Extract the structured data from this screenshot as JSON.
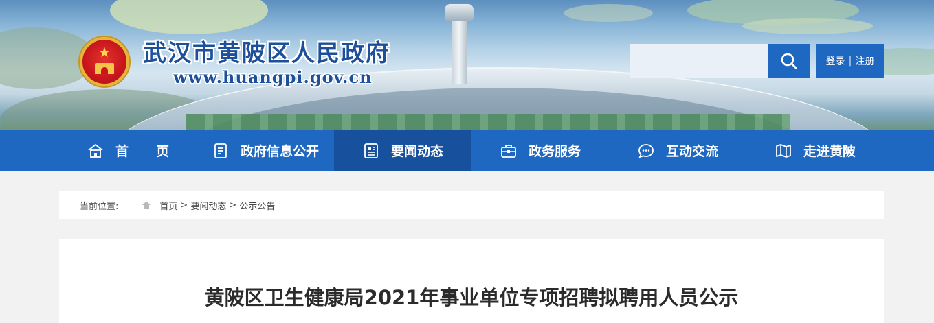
{
  "header": {
    "site_title": "武汉市黄陂区人民政府",
    "site_url": "www.huangpi.gov.cn",
    "search": {
      "placeholder": ""
    },
    "auth": {
      "login": "登录",
      "separator": "|",
      "register": "注册"
    }
  },
  "nav": {
    "items": [
      {
        "label": "首页",
        "icon": "home-icon",
        "active": false
      },
      {
        "label": "政府信息公开",
        "icon": "document-list-icon",
        "active": false
      },
      {
        "label": "要闻动态",
        "icon": "news-icon",
        "active": true
      },
      {
        "label": "政务服务",
        "icon": "briefcase-icon",
        "active": false
      },
      {
        "label": "互动交流",
        "icon": "chat-bubble-icon",
        "active": false
      },
      {
        "label": "走进黄陂",
        "icon": "map-icon",
        "active": false
      }
    ]
  },
  "breadcrumb": {
    "prefix": "当前位置:",
    "items": [
      "首页",
      "要闻动态",
      "公示公告"
    ],
    "separator": ">"
  },
  "article": {
    "title": "黄陂区卫生健康局2021年事业单位专项招聘拟聘用人员公示"
  },
  "colors": {
    "nav_bg": "#1f68c1",
    "nav_active_bg": "#17509c",
    "title_blue": "#1d4f9a"
  }
}
